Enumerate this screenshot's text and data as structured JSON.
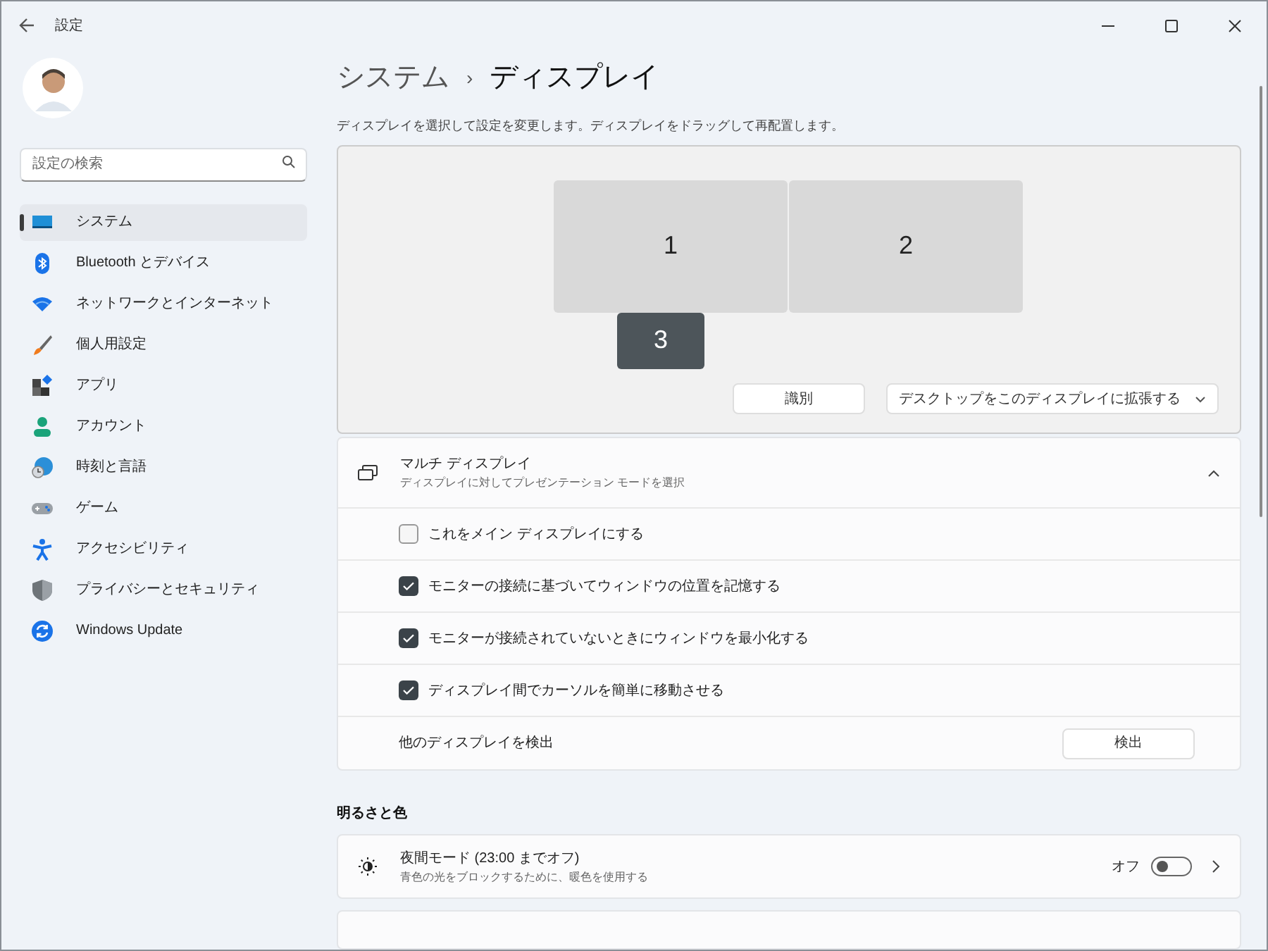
{
  "window": {
    "title": "設定"
  },
  "search": {
    "placeholder": "設定の検索"
  },
  "sidebar": {
    "items": [
      {
        "label": "システム",
        "selected": true
      },
      {
        "label": "Bluetooth とデバイス",
        "selected": false
      },
      {
        "label": "ネットワークとインターネット",
        "selected": false
      },
      {
        "label": "個人用設定",
        "selected": false
      },
      {
        "label": "アプリ",
        "selected": false
      },
      {
        "label": "アカウント",
        "selected": false
      },
      {
        "label": "時刻と言語",
        "selected": false
      },
      {
        "label": "ゲーム",
        "selected": false
      },
      {
        "label": "アクセシビリティ",
        "selected": false
      },
      {
        "label": "プライバシーとセキュリティ",
        "selected": false
      },
      {
        "label": "Windows Update",
        "selected": false
      }
    ]
  },
  "breadcrumb": [
    "システム",
    "ディスプレイ"
  ],
  "breadcrumb_separator": "›",
  "arrangement": {
    "hint": "ディスプレイを選択して設定を変更します。ディスプレイをドラッグして再配置します。",
    "displays": [
      {
        "label": "1",
        "selected": false
      },
      {
        "label": "2",
        "selected": false
      },
      {
        "label": "3",
        "selected": true
      }
    ],
    "identify_button": "識別",
    "mode_dropdown": "デスクトップをこのディスプレイに拡張する"
  },
  "multi_display": {
    "title": "マルチ ディスプレイ",
    "subtitle": "ディスプレイに対してプレゼンテーション モードを選択",
    "expanded": true,
    "options": [
      {
        "label": "これをメイン ディスプレイにする",
        "checked": false
      },
      {
        "label": "モニターの接続に基づいてウィンドウの位置を記憶する",
        "checked": true
      },
      {
        "label": "モニターが接続されていないときにウィンドウを最小化する",
        "checked": true
      },
      {
        "label": "ディスプレイ間でカーソルを簡単に移動させる",
        "checked": true
      }
    ],
    "detect_label": "他のディスプレイを検出",
    "detect_button": "検出"
  },
  "brightness_section": {
    "heading": "明るさと色",
    "night_light": {
      "title": "夜間モード (23:00 までオフ)",
      "subtitle": "青色の光をブロックするために、暖色を使用する",
      "state_label": "オフ",
      "on": false
    }
  }
}
